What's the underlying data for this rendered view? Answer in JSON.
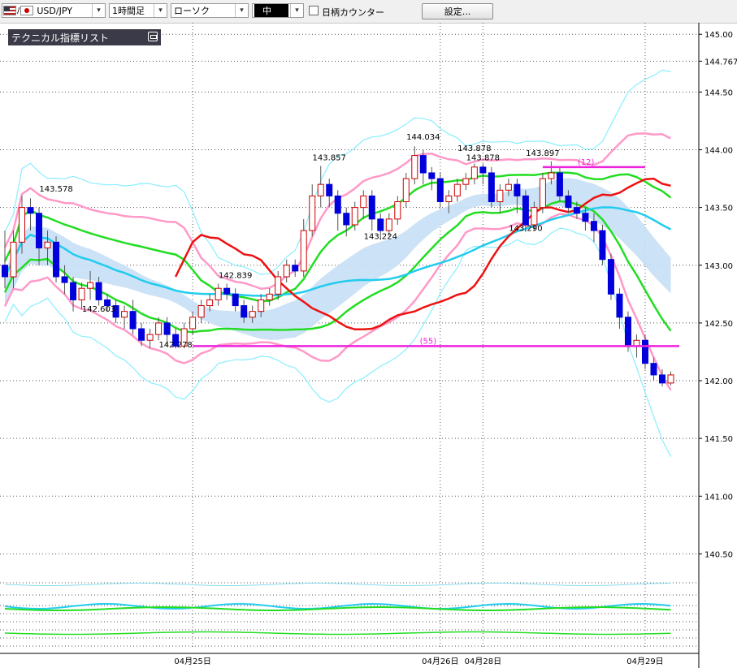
{
  "toolbar": {
    "symbol": "USD/JPY",
    "timeframe": "1時間足",
    "chart_style": "ローソク",
    "size": "中",
    "counter_label": "日柄カウンター",
    "settings_label": "設定..."
  },
  "indicator_panel": {
    "label": "テクニカル指標リスト"
  },
  "colors": {
    "bg": "#ffffff",
    "grid": "#555555",
    "up_candle": "#cc0000",
    "down_candle": "#0000dd",
    "cloud": "#c6dff5",
    "ma_short": "#22ccee",
    "ma_long": "#22ccee",
    "bb_inner": "#ff99c8",
    "bb_outer": "#88eeff",
    "green_line": "#22dd22",
    "red_line": "#ee1111",
    "magenta": "#ee22dd"
  },
  "chart_data": {
    "type": "candlestick",
    "yaxis_ticks": [
      "145.00",
      "144.767",
      "144.50",
      "144.00",
      "143.50",
      "143.00",
      "142.50",
      "142.00",
      "141.50",
      "141.00",
      "140.50"
    ],
    "ylim": [
      140.25,
      145.1
    ],
    "x_labels": [
      "04月25日",
      "04月26日",
      "04月28日",
      "04月29日"
    ],
    "grid": true,
    "price_labels": [
      {
        "text": "143.578",
        "x": 6,
        "y": 143.61
      },
      {
        "text": "142.603",
        "x": 11,
        "y": 142.57
      },
      {
        "text": "142.278",
        "x": 20,
        "y": 142.26
      },
      {
        "text": "142.839",
        "x": 27,
        "y": 142.86
      },
      {
        "text": "143.857",
        "x": 38,
        "y": 143.88
      },
      {
        "text": "143.224",
        "x": 44,
        "y": 143.2
      },
      {
        "text": "144.034",
        "x": 49,
        "y": 144.06
      },
      {
        "text": "143.878",
        "x": 55,
        "y": 143.96
      },
      {
        "text": "143.878",
        "x": 56,
        "y": 143.88
      },
      {
        "text": "143.897",
        "x": 63,
        "y": 143.92
      },
      {
        "text": "143.290",
        "x": 61,
        "y": 143.27
      }
    ],
    "hlines": [
      {
        "label": "(55)",
        "y": 142.3,
        "x_from": 22,
        "x_to": 79
      },
      {
        "label": "(12)",
        "y": 143.85,
        "x_from": 63,
        "x_to": 75
      }
    ],
    "candles": [
      [
        143.0,
        142.9,
        143.3,
        142.8
      ],
      [
        142.9,
        143.2,
        143.3,
        142.8
      ],
      [
        143.2,
        143.5,
        143.6,
        143.1
      ],
      [
        143.5,
        143.45,
        143.58,
        143.3
      ],
      [
        143.45,
        143.15,
        143.5,
        143.0
      ],
      [
        143.15,
        143.2,
        143.3,
        143.0
      ],
      [
        143.2,
        142.9,
        143.25,
        142.85
      ],
      [
        142.9,
        142.85,
        143.0,
        142.75
      ],
      [
        142.85,
        142.7,
        142.9,
        142.6
      ],
      [
        142.7,
        142.8,
        142.85,
        142.62
      ],
      [
        142.8,
        142.85,
        142.95,
        142.7
      ],
      [
        142.85,
        142.7,
        142.9,
        142.65
      ],
      [
        142.7,
        142.65,
        142.75,
        142.6
      ],
      [
        142.65,
        142.55,
        142.7,
        142.5
      ],
      [
        142.55,
        142.6,
        142.65,
        142.45
      ],
      [
        142.6,
        142.45,
        142.7,
        142.4
      ],
      [
        142.45,
        142.35,
        142.5,
        142.3
      ],
      [
        142.35,
        142.4,
        142.45,
        142.28
      ],
      [
        142.4,
        142.5,
        142.55,
        142.35
      ],
      [
        142.5,
        142.4,
        142.55,
        142.3
      ],
      [
        142.4,
        142.3,
        142.45,
        142.28
      ],
      [
        142.3,
        142.45,
        142.5,
        142.28
      ],
      [
        142.45,
        142.55,
        142.6,
        142.4
      ],
      [
        142.55,
        142.65,
        142.7,
        142.5
      ],
      [
        142.65,
        142.7,
        142.75,
        142.6
      ],
      [
        142.7,
        142.8,
        142.84,
        142.65
      ],
      [
        142.8,
        142.75,
        142.84,
        142.7
      ],
      [
        142.75,
        142.65,
        142.8,
        142.6
      ],
      [
        142.65,
        142.55,
        142.7,
        142.5
      ],
      [
        142.55,
        142.6,
        142.65,
        142.5
      ],
      [
        142.6,
        142.7,
        142.75,
        142.55
      ],
      [
        142.7,
        142.75,
        142.8,
        142.65
      ],
      [
        142.75,
        142.9,
        142.95,
        142.7
      ],
      [
        142.9,
        143.0,
        143.05,
        142.85
      ],
      [
        143.0,
        142.95,
        143.05,
        142.9
      ],
      [
        142.95,
        143.3,
        143.4,
        142.9
      ],
      [
        143.3,
        143.6,
        143.7,
        143.25
      ],
      [
        143.6,
        143.7,
        143.86,
        143.5
      ],
      [
        143.7,
        143.6,
        143.75,
        143.5
      ],
      [
        143.6,
        143.45,
        143.65,
        143.3
      ],
      [
        143.45,
        143.35,
        143.5,
        143.25
      ],
      [
        143.35,
        143.5,
        143.55,
        143.3
      ],
      [
        143.5,
        143.6,
        143.65,
        143.4
      ],
      [
        143.6,
        143.4,
        143.65,
        143.3
      ],
      [
        143.4,
        143.3,
        143.45,
        143.22
      ],
      [
        143.3,
        143.4,
        143.45,
        143.25
      ],
      [
        143.4,
        143.55,
        143.6,
        143.35
      ],
      [
        143.55,
        143.75,
        143.8,
        143.5
      ],
      [
        143.75,
        143.95,
        144.03,
        143.7
      ],
      [
        143.95,
        143.8,
        144.0,
        143.7
      ],
      [
        143.8,
        143.75,
        143.85,
        143.65
      ],
      [
        143.75,
        143.55,
        143.8,
        143.5
      ],
      [
        143.55,
        143.6,
        143.65,
        143.45
      ],
      [
        143.6,
        143.7,
        143.75,
        143.55
      ],
      [
        143.7,
        143.75,
        143.8,
        143.65
      ],
      [
        143.75,
        143.85,
        143.88,
        143.7
      ],
      [
        143.85,
        143.8,
        143.88,
        143.7
      ],
      [
        143.8,
        143.55,
        143.85,
        143.5
      ],
      [
        143.55,
        143.65,
        143.7,
        143.45
      ],
      [
        143.65,
        143.7,
        143.75,
        143.6
      ],
      [
        143.7,
        143.6,
        143.75,
        143.45
      ],
      [
        143.6,
        143.35,
        143.65,
        143.29
      ],
      [
        143.35,
        143.5,
        143.55,
        143.3
      ],
      [
        143.5,
        143.75,
        143.8,
        143.45
      ],
      [
        143.75,
        143.8,
        143.9,
        143.7
      ],
      [
        143.8,
        143.6,
        143.85,
        143.55
      ],
      [
        143.6,
        143.5,
        143.65,
        143.45
      ],
      [
        143.5,
        143.45,
        143.55,
        143.4
      ],
      [
        143.45,
        143.38,
        143.5,
        143.3
      ],
      [
        143.38,
        143.3,
        143.45,
        143.2
      ],
      [
        143.3,
        143.05,
        143.35,
        143.0
      ],
      [
        143.05,
        142.75,
        143.1,
        142.7
      ],
      [
        142.75,
        142.55,
        142.8,
        142.45
      ],
      [
        142.55,
        142.3,
        142.6,
        142.25
      ],
      [
        142.3,
        142.35,
        142.4,
        142.2
      ],
      [
        142.35,
        142.15,
        142.4,
        142.1
      ],
      [
        142.15,
        142.05,
        142.2,
        142.0
      ],
      [
        142.05,
        141.98,
        142.1,
        141.95
      ],
      [
        141.98,
        142.05,
        142.08,
        141.96
      ]
    ]
  }
}
